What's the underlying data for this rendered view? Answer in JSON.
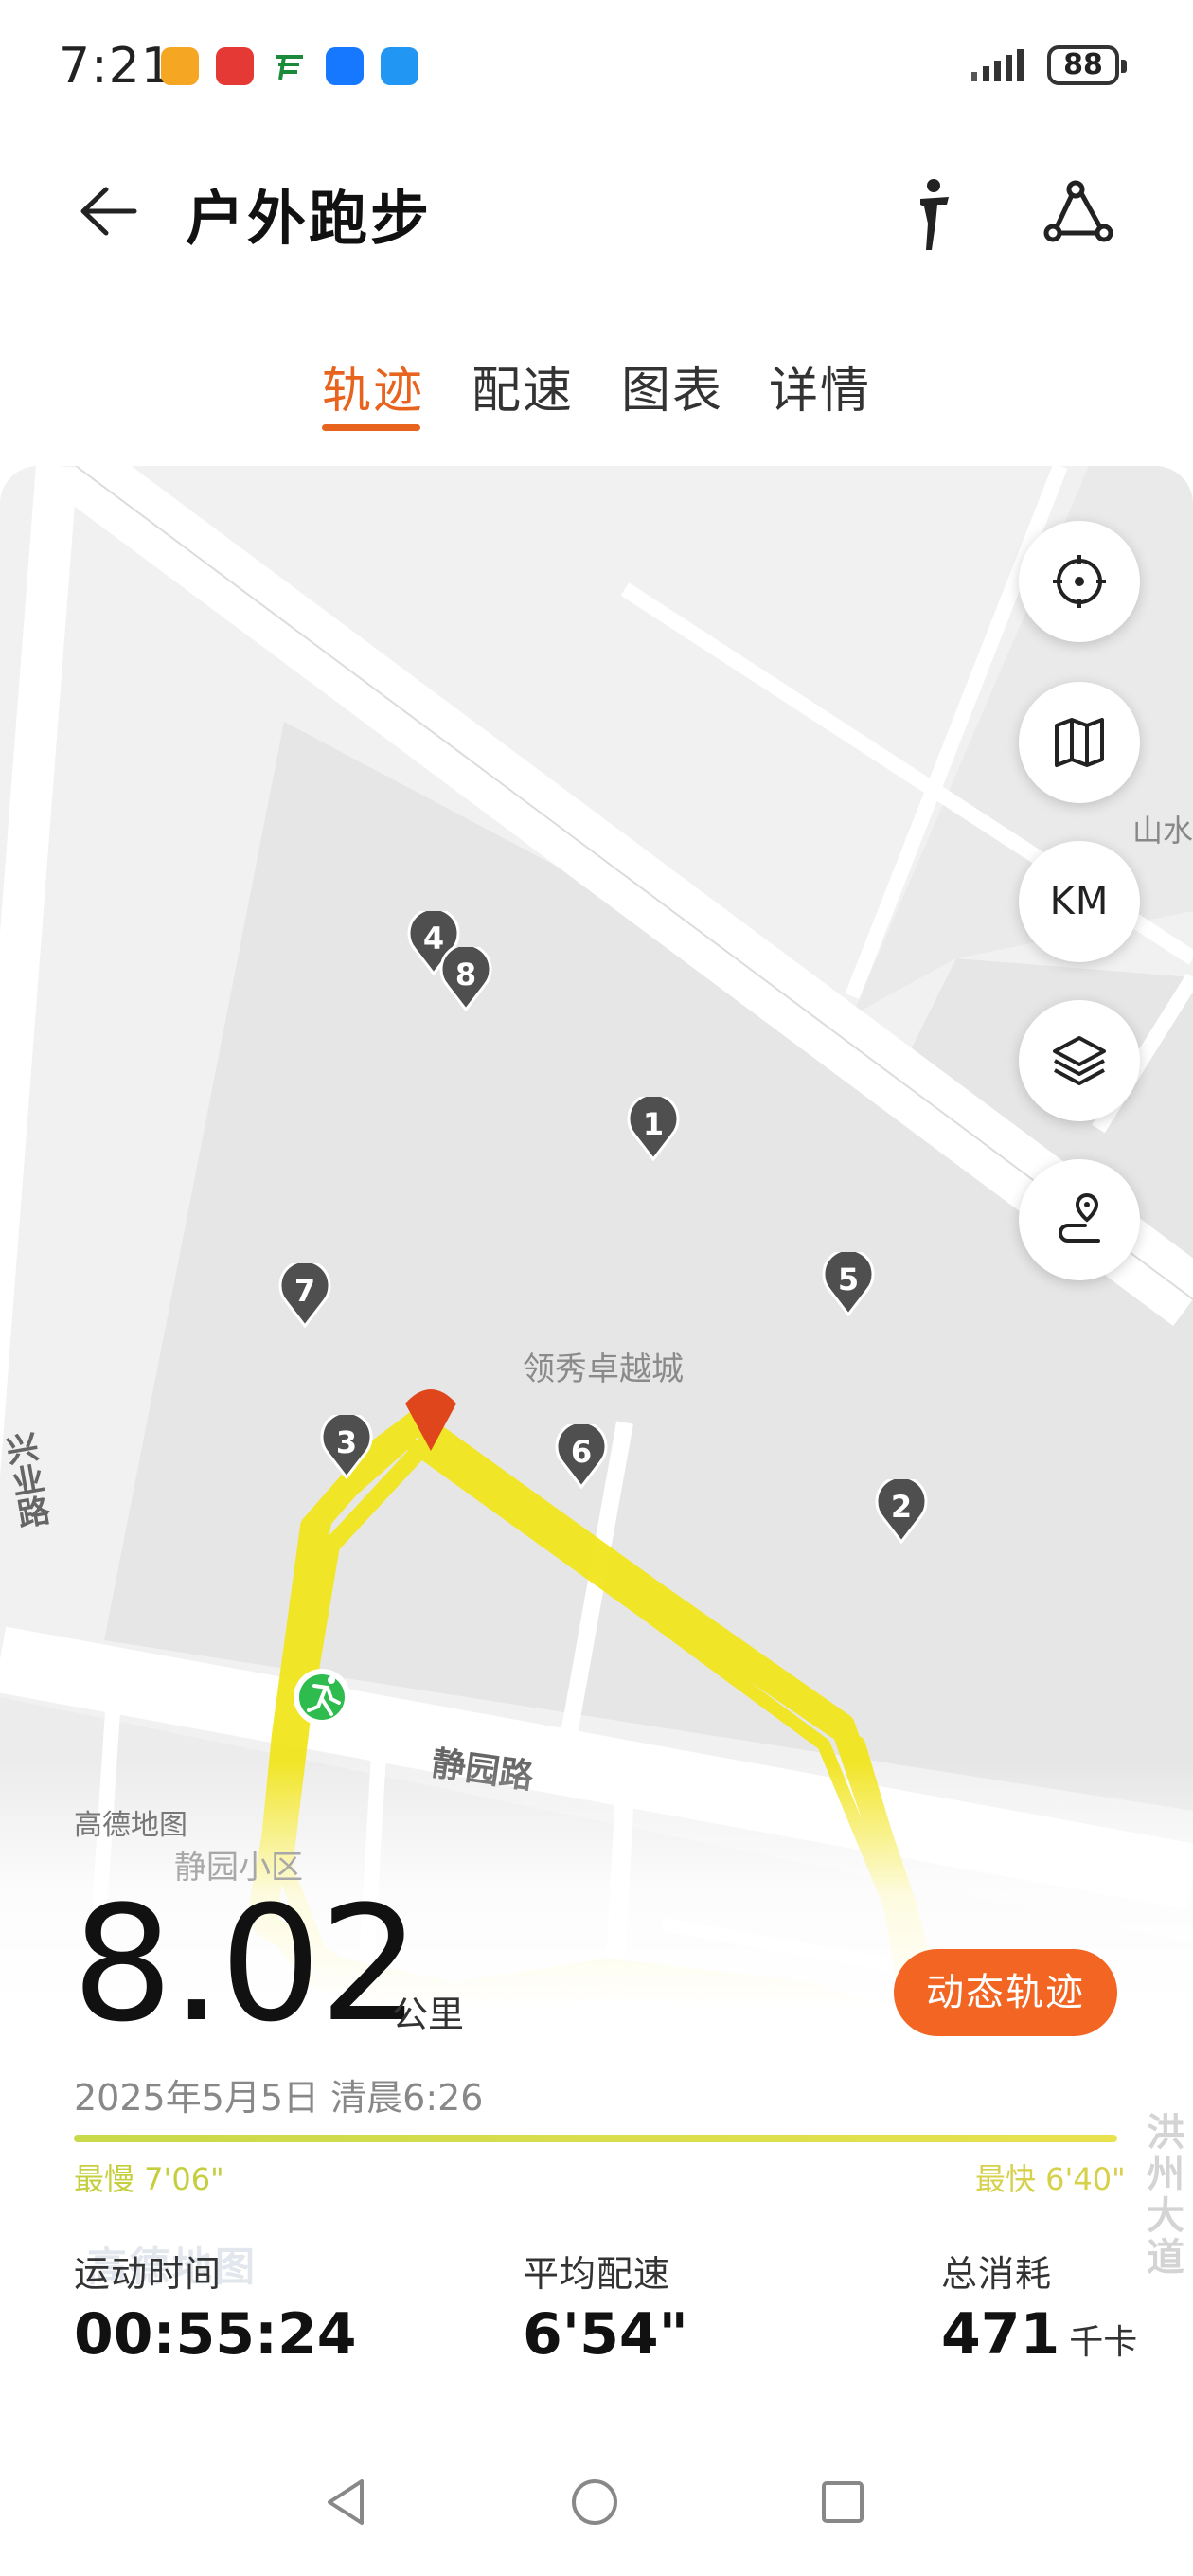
{
  "status_bar": {
    "time": "7:21",
    "battery": "88"
  },
  "header": {
    "title": "户外跑步",
    "back_icon": "back-arrow-icon",
    "posture_icon": "running-posture-icon",
    "route_icon": "route-icon"
  },
  "tabs": [
    {
      "label": "轨迹",
      "active": true
    },
    {
      "label": "配速",
      "active": false
    },
    {
      "label": "图表",
      "active": false
    },
    {
      "label": "详情",
      "active": false
    }
  ],
  "map": {
    "area_label": "领秀卓越城",
    "roads": {
      "south": "静园路",
      "west": "兴业路",
      "east_partial": "山水",
      "southeast_partial": "洪州大道"
    },
    "sub_area": "静园小区",
    "provider": "高德地图",
    "watermark": "高德地图",
    "km_button": "KM",
    "markers": [
      "1",
      "2",
      "3",
      "4",
      "5",
      "6",
      "7",
      "8"
    ],
    "route_color": "#f2e51d"
  },
  "summary": {
    "distance": "8.02",
    "distance_unit": "公里",
    "date": "2025年5月5日 清晨6:26",
    "dynamic_track_button": "动态轨迹",
    "pace_slowest": "最慢 7'06\"",
    "pace_fastest": "最快 6'40\"",
    "stats": [
      {
        "label": "运动时间",
        "value": "00:55:24",
        "unit": ""
      },
      {
        "label": "平均配速",
        "value": "6'54\"",
        "unit": ""
      },
      {
        "label": "总消耗",
        "value": "471",
        "unit": "千卡"
      }
    ]
  },
  "colors": {
    "accent": "#e8641e",
    "button": "#f26522",
    "route": "#f2e51d"
  }
}
